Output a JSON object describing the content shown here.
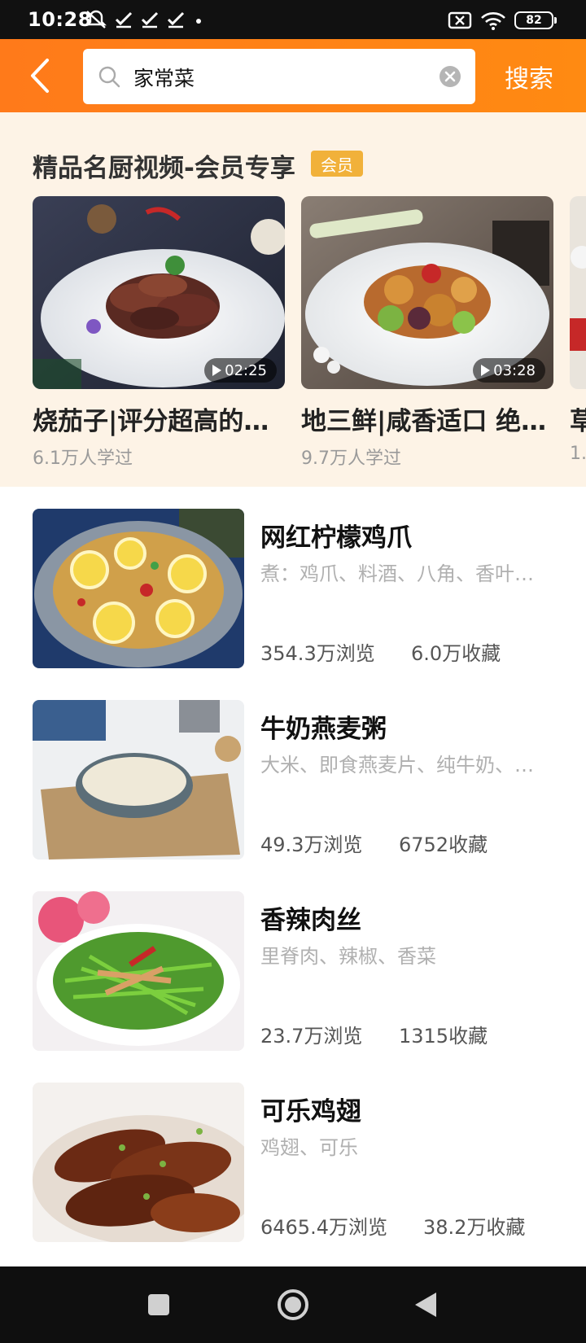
{
  "status_bar": {
    "time": "10:28",
    "battery": "82"
  },
  "search": {
    "query": "家常菜",
    "button_label": "搜索"
  },
  "premium": {
    "title": "精品名厨视频-会员专享",
    "badge": "会员",
    "videos": [
      {
        "title": "烧茄子|评分超高的…",
        "duration": "02:25",
        "learned": "6.1万人学过"
      },
      {
        "title": "地三鲜|咸香适口 绝…",
        "duration": "03:28",
        "learned": "9.7万人学过"
      },
      {
        "title": "草",
        "learned": "1."
      }
    ]
  },
  "recipes": [
    {
      "name": "网红柠檬鸡爪",
      "ingredients": "煮：鸡爪、料酒、八角、香叶…",
      "views": "354.3万浏览",
      "favorites": "6.0万收藏"
    },
    {
      "name": "牛奶燕麦粥",
      "ingredients": "大米、即食燕麦片、纯牛奶、…",
      "views": "49.3万浏览",
      "favorites": "6752收藏"
    },
    {
      "name": "香辣肉丝",
      "ingredients": "里脊肉、辣椒、香菜",
      "views": "23.7万浏览",
      "favorites": "1315收藏"
    },
    {
      "name": "可乐鸡翅",
      "ingredients": "鸡翅、可乐",
      "views": "6465.4万浏览",
      "favorites": "38.2万收藏"
    }
  ],
  "colors": {
    "accent": "#ff7a1a",
    "vip": "#f1b13a",
    "premium_bg": "#fdf3e6"
  }
}
